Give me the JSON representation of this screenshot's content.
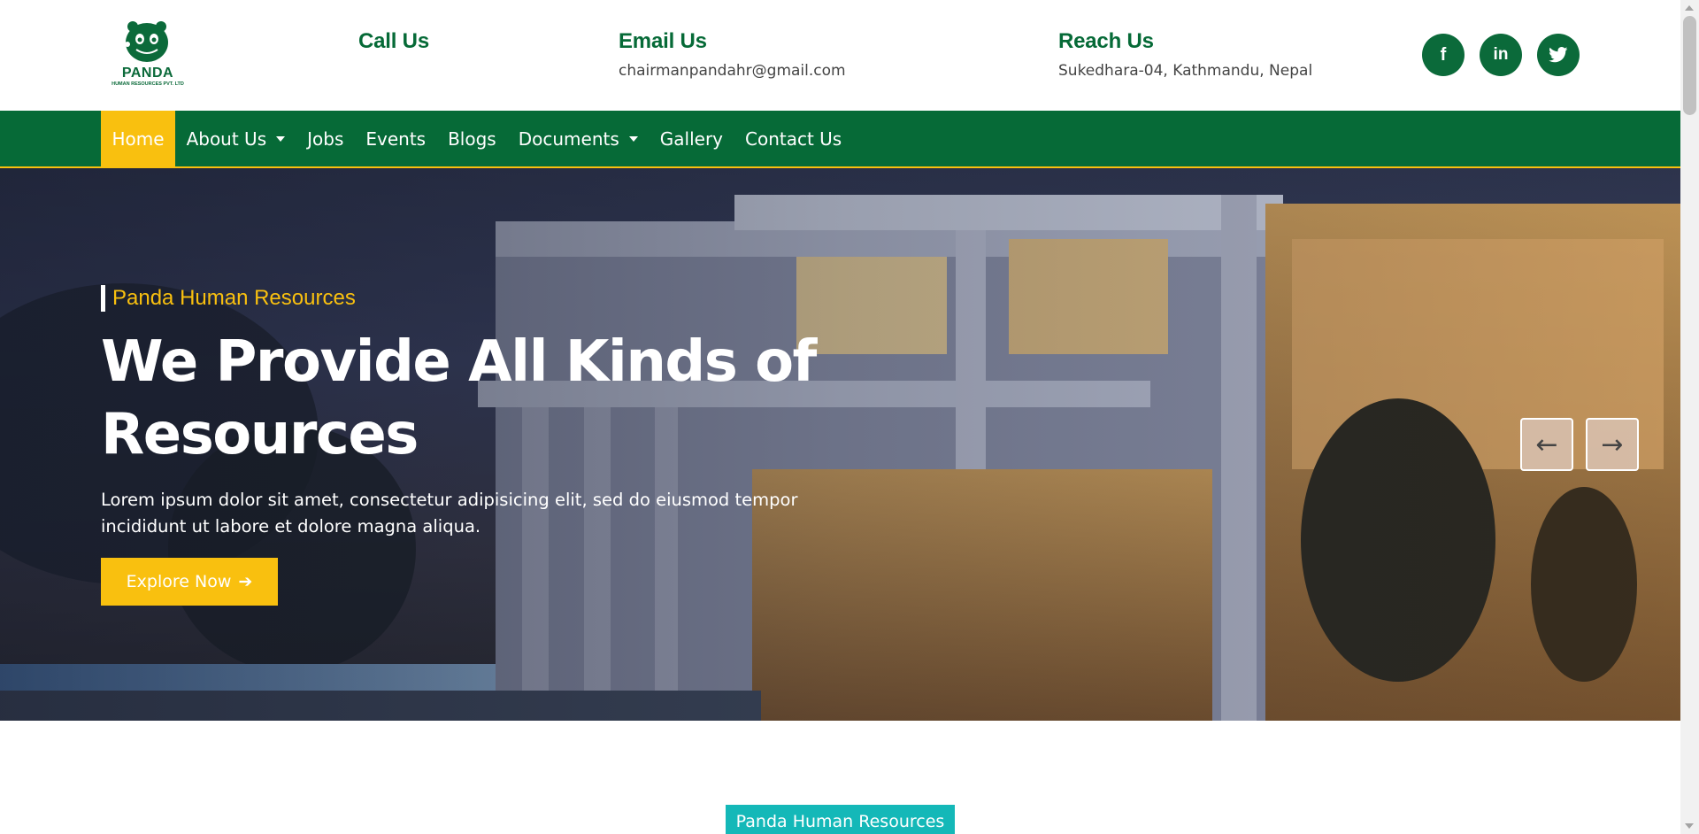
{
  "brand": {
    "name": "PANDA",
    "subtitle": "HUMAN RESOURCES PVT. LTD"
  },
  "contact": {
    "call_title": "Call Us",
    "call_value": "",
    "email_title": "Email Us",
    "email_value": "chairmanpandahr@gmail.com",
    "reach_title": "Reach Us",
    "reach_value": "Sukedhara-04, Kathmandu, Nepal"
  },
  "social": {
    "facebook": "f",
    "linkedin": "in",
    "twitter_icon": "twitter-bird-icon"
  },
  "nav": {
    "items": [
      {
        "label": "Home",
        "active": true,
        "dropdown": false
      },
      {
        "label": "About Us",
        "active": false,
        "dropdown": true
      },
      {
        "label": "Jobs",
        "active": false,
        "dropdown": false
      },
      {
        "label": "Events",
        "active": false,
        "dropdown": false
      },
      {
        "label": "Blogs",
        "active": false,
        "dropdown": false
      },
      {
        "label": "Documents",
        "active": false,
        "dropdown": true
      },
      {
        "label": "Gallery",
        "active": false,
        "dropdown": false
      },
      {
        "label": "Contact Us",
        "active": false,
        "dropdown": false
      }
    ]
  },
  "hero": {
    "tagline": "Panda Human Resources",
    "title": "We Provide All Kinds of Resources",
    "description": "Lorem ipsum dolor sit amet, consectetur adipisicing elit, sed do eiusmod tempor incididunt ut labore et dolore magna aliqua.",
    "button_label": "Explore Now",
    "button_icon": "arrow-right-icon",
    "prev_icon": "arrow-left-icon",
    "next_icon": "arrow-right-icon"
  },
  "section": {
    "badge": "Panda Human Resources"
  },
  "colors": {
    "primary_green": "#066a37",
    "accent_yellow": "#f9c00f",
    "badge_teal": "#14b8b8"
  }
}
